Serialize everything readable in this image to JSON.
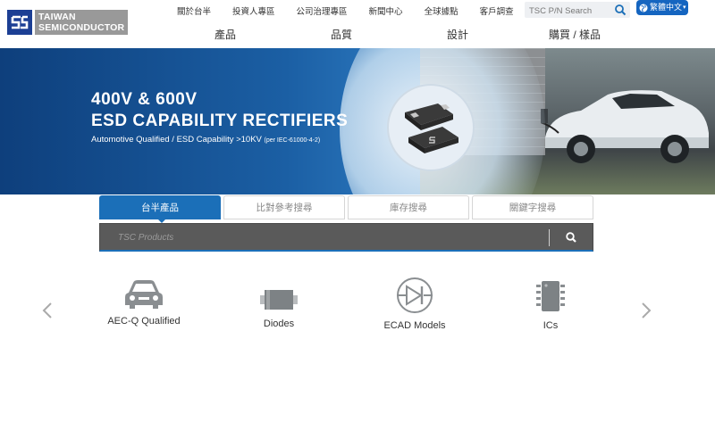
{
  "logo": {
    "line1": "TAIWAN",
    "line2": "SEMICONDUCTOR"
  },
  "topnav": [
    "關於台半",
    "投資人專區",
    "公司治理專區",
    "新聞中心",
    "全球據點",
    "客戶調查"
  ],
  "search": {
    "placeholder": "TSC P/N Search"
  },
  "language": {
    "label": "繁體中文"
  },
  "mainnav": [
    "產品",
    "品質",
    "設計",
    "購買 / 樣品"
  ],
  "banner": {
    "title_line1": "400V & 600V",
    "title_line2": "ESD CAPABILITY RECTIFIERS",
    "subtitle": "Automotive Qualified / ESD Capability >10KV ",
    "subtitle_small": "(per IEC-61000-4-2)"
  },
  "tabs": [
    "台半產品",
    "比對參考搜尋",
    "庫存搜尋",
    "關鍵字搜尋"
  ],
  "product_search": {
    "placeholder": "TSC Products"
  },
  "categories": [
    "AEC-Q Qualified",
    "Diodes",
    "ECAD Models",
    "ICs"
  ],
  "colors": {
    "brand_blue": "#1c3f94",
    "accent_blue": "#1b6fb8",
    "search_bar": "#5a5a5a"
  },
  "icons": [
    "search-icon",
    "globe-icon",
    "car-icon",
    "diode-package-icon",
    "diode-symbol-icon",
    "ic-chip-icon",
    "chevron-left-icon",
    "chevron-right-icon"
  ]
}
